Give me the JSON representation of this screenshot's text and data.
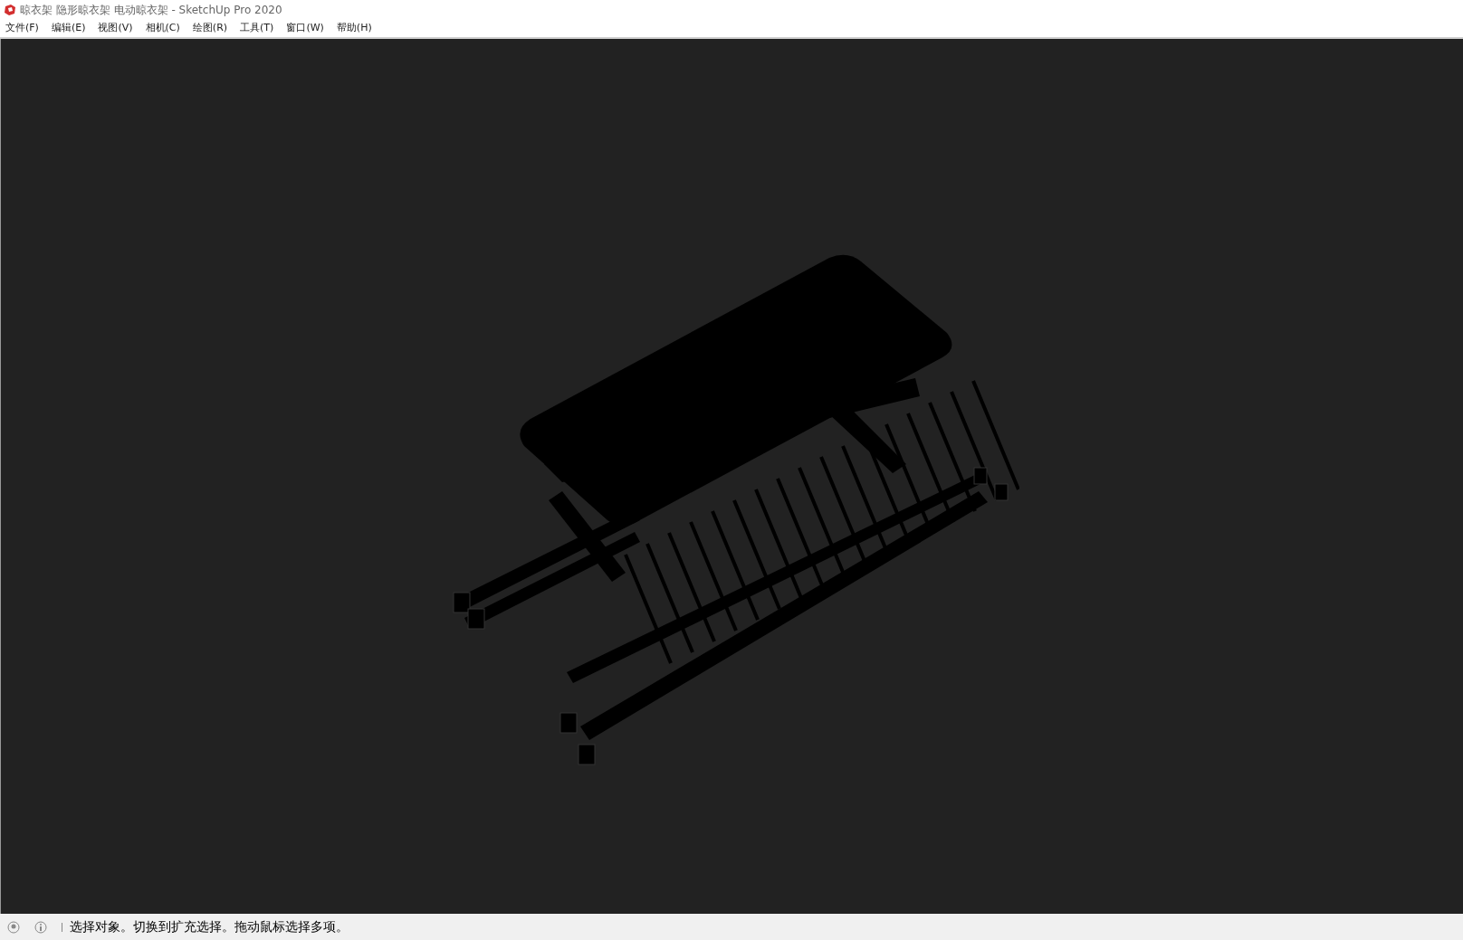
{
  "window": {
    "title": "晾衣架 隐形晾衣架 电动晾衣架 - SketchUp Pro 2020"
  },
  "menu": [
    "文件(F)",
    "编辑(E)",
    "视图(V)",
    "相机(C)",
    "绘图(R)",
    "工具(T)",
    "窗口(W)",
    "帮助(H)"
  ],
  "status_bar": {
    "message": "选择对象。切换到扩充选择。拖动鼠标选择多项。"
  }
}
